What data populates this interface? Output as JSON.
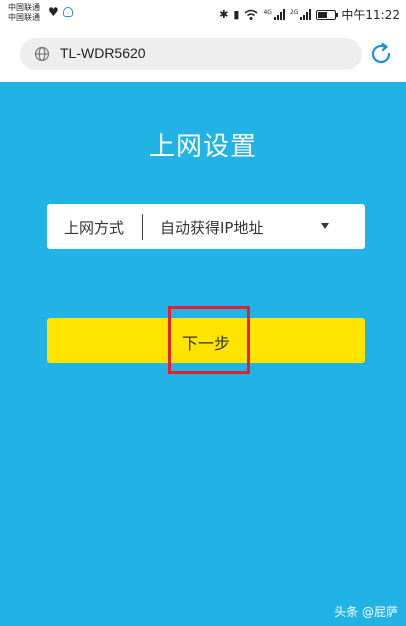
{
  "status_bar": {
    "carrier_1": "中国联通",
    "carrier_2": "中国联通",
    "net_1": "4G",
    "net_2": "2G",
    "time": "中午11:22"
  },
  "browser": {
    "url": "TL-WDR5620"
  },
  "page": {
    "title": "上网设置",
    "field_label": "上网方式",
    "field_value": "自动获得IP地址",
    "next_button": "下一步"
  },
  "watermark": "头条 @屁萨",
  "colors": {
    "panel_bg": "#21b3e6",
    "button_bg": "#ffe400",
    "highlight": "#e4202b",
    "refresh": "#1a8fe3"
  }
}
